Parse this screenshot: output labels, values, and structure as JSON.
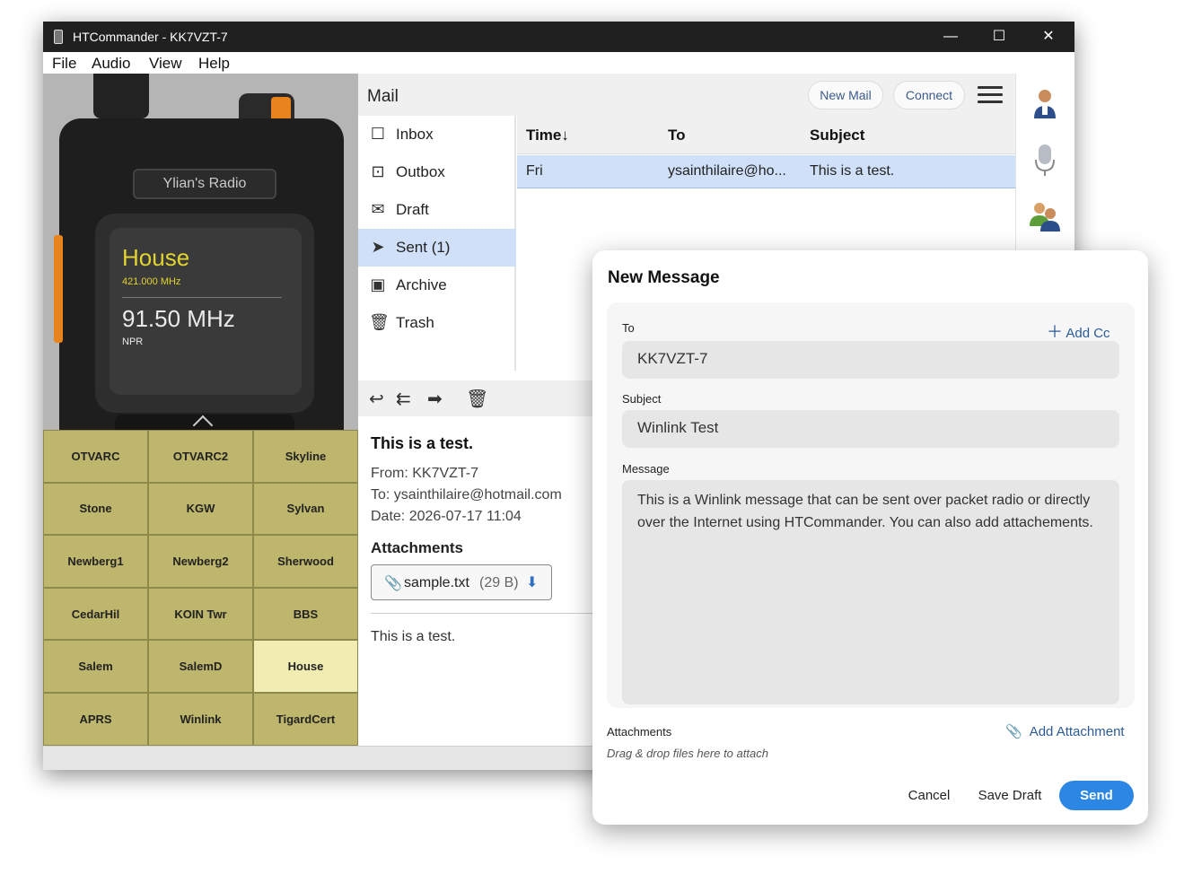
{
  "window": {
    "title": "HTCommander - KK7VZT-7",
    "controls": {
      "minimize": "—",
      "maximize": "☐",
      "close": "✕"
    }
  },
  "menu": [
    "File",
    "Audio",
    "View",
    "Help"
  ],
  "radio": {
    "nameplate": "Ylian's Radio",
    "channel_name": "House",
    "channel_freq": "421.000 MHz",
    "vfo_freq": "91.50 MHz",
    "vfo_station": "NPR",
    "accent_color": "#e2d330"
  },
  "channels": {
    "items": [
      "OTVARC",
      "OTVARC2",
      "Skyline",
      "Stone",
      "KGW",
      "Sylvan",
      "Newberg1",
      "Newberg2",
      "Sherwood",
      "CedarHil",
      "KOIN Twr",
      "BBS",
      "Salem",
      "SalemD",
      "House",
      "APRS",
      "Winlink",
      "TigardCert"
    ],
    "active": "House"
  },
  "mail": {
    "title": "Mail",
    "new_mail": "New Mail",
    "connect": "Connect",
    "folders": [
      {
        "label": "Inbox",
        "icon": "inbox-icon",
        "glyph": "☐"
      },
      {
        "label": "Outbox",
        "icon": "outbox-icon",
        "glyph": "⊡"
      },
      {
        "label": "Draft",
        "icon": "draft-icon",
        "glyph": "✉"
      },
      {
        "label": "Sent (1)",
        "icon": "sent-icon",
        "glyph": "➤"
      },
      {
        "label": "Archive",
        "icon": "archive-icon",
        "glyph": "▣"
      },
      {
        "label": "Trash",
        "icon": "trash-icon",
        "glyph": "🗑"
      }
    ],
    "selected_folder": "Sent (1)",
    "columns": [
      "Time",
      "To",
      "Subject"
    ],
    "sort_indicator": "↓",
    "rows": [
      {
        "time": "Fri",
        "to": "ysainthilaire@ho...",
        "subject": "This is a test."
      }
    ],
    "viewer": {
      "subject": "This is a test.",
      "from": "From: KK7VZT-7",
      "to": "To: ysainthilaire@hotmail.com",
      "date": "Date: 2026-07-17 11:04",
      "attachments_heading": "Attachments",
      "attachment_name": "sample.txt",
      "attachment_size": "(29 B)",
      "body": "This is a test."
    },
    "toolbar_icons": [
      "reply-icon",
      "reply-all-icon",
      "forward-icon",
      "delete-icon"
    ]
  },
  "dialog": {
    "title": "New Message",
    "to_label": "To",
    "add_cc": "Add Cc",
    "to_value": "KK7VZT-7",
    "subject_label": "Subject",
    "subject_value": "Winlink Test",
    "message_label": "Message",
    "message_value": "This is a Winlink message that can be sent over packet radio or directly over the Internet using HTCommander. You can also add attachements.",
    "attachments_label": "Attachments",
    "add_attachment": "Add Attachment",
    "drop_hint": "Drag & drop files here to attach",
    "cancel": "Cancel",
    "save_draft": "Save Draft",
    "send": "Send",
    "send_color": "#2b87e3"
  }
}
